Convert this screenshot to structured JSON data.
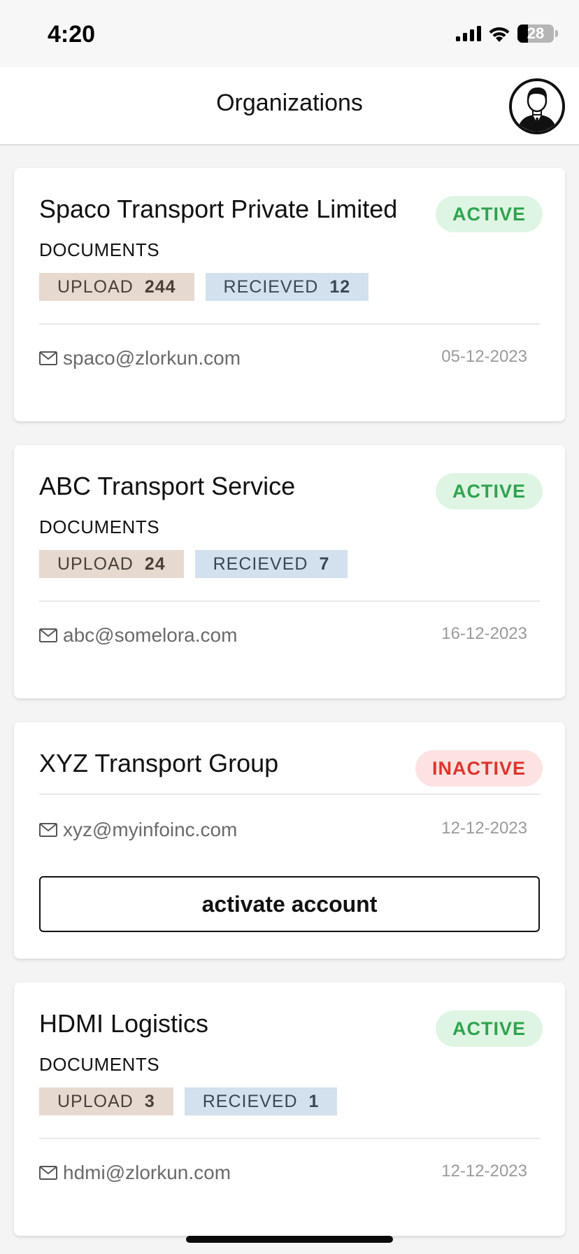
{
  "status_bar": {
    "time": "4:20",
    "battery": "28",
    "battery_level": 0.28
  },
  "header": {
    "title": "Organizations"
  },
  "organizations": [
    {
      "name": "Spaco Transport Private Limited",
      "status": "ACTIVE",
      "documents_label": "DOCUMENTS",
      "upload_label": "UPLOAD",
      "upload_count": "244",
      "received_label": "RECIEVED",
      "received_count": "12",
      "email": "spaco@zlorkun.com",
      "date": "05-12-2023"
    },
    {
      "name": "ABC Transport Service",
      "status": "ACTIVE",
      "documents_label": "DOCUMENTS",
      "upload_label": "UPLOAD",
      "upload_count": "24",
      "received_label": "RECIEVED",
      "received_count": "7",
      "email": "abc@somelora.com",
      "date": "16-12-2023"
    },
    {
      "name": "XYZ Transport Group",
      "status": "INACTIVE",
      "email": "xyz@myinfoinc.com",
      "date": "12-12-2023",
      "action_label": "activate account"
    },
    {
      "name": "HDMI Logistics",
      "status": "ACTIVE",
      "documents_label": "DOCUMENTS",
      "upload_label": "UPLOAD",
      "upload_count": "3",
      "received_label": "RECIEVED",
      "received_count": "1",
      "email": "hdmi@zlorkun.com",
      "date": "12-12-2023"
    }
  ],
  "colors": {
    "active_bg": "#dff5e3",
    "active_text": "#2ea44f",
    "inactive_bg": "#fde2e2",
    "inactive_text": "#e0342c",
    "upload_chip": "#e6dad0",
    "received_chip": "#d3e1ee"
  },
  "icons": {
    "signal": "cellular-signal-icon",
    "wifi": "wifi-icon",
    "battery": "battery-icon",
    "avatar": "user-avatar-icon",
    "email": "mail-icon"
  }
}
